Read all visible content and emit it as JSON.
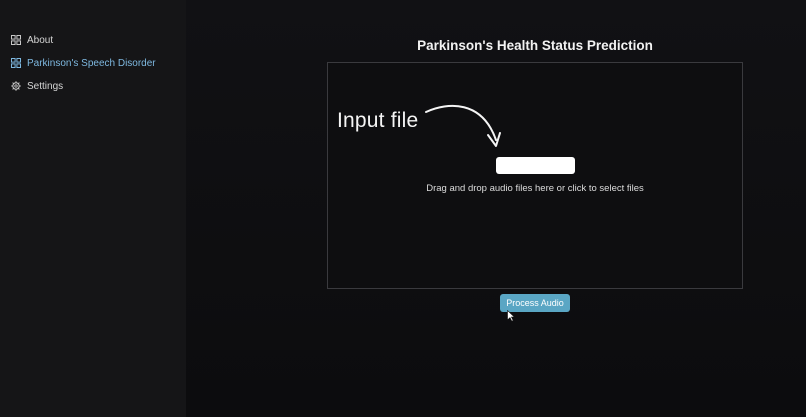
{
  "sidebar": {
    "items": [
      {
        "label": "About",
        "icon": "grid-icon",
        "active": false
      },
      {
        "label": "Parkinson's Speech Disorder",
        "icon": "grid-icon",
        "active": true
      },
      {
        "label": "Settings",
        "icon": "gear-icon",
        "active": false
      }
    ]
  },
  "main": {
    "title": "Parkinson's Health Status Prediction",
    "upload": {
      "annotation": "Input file",
      "hint": "Drag and drop audio files here or click to select files"
    },
    "process_button": "Process Audio"
  },
  "colors": {
    "active_nav": "#7eb8e0",
    "button": "#5aa6c4",
    "background": "#0d0d0f"
  }
}
